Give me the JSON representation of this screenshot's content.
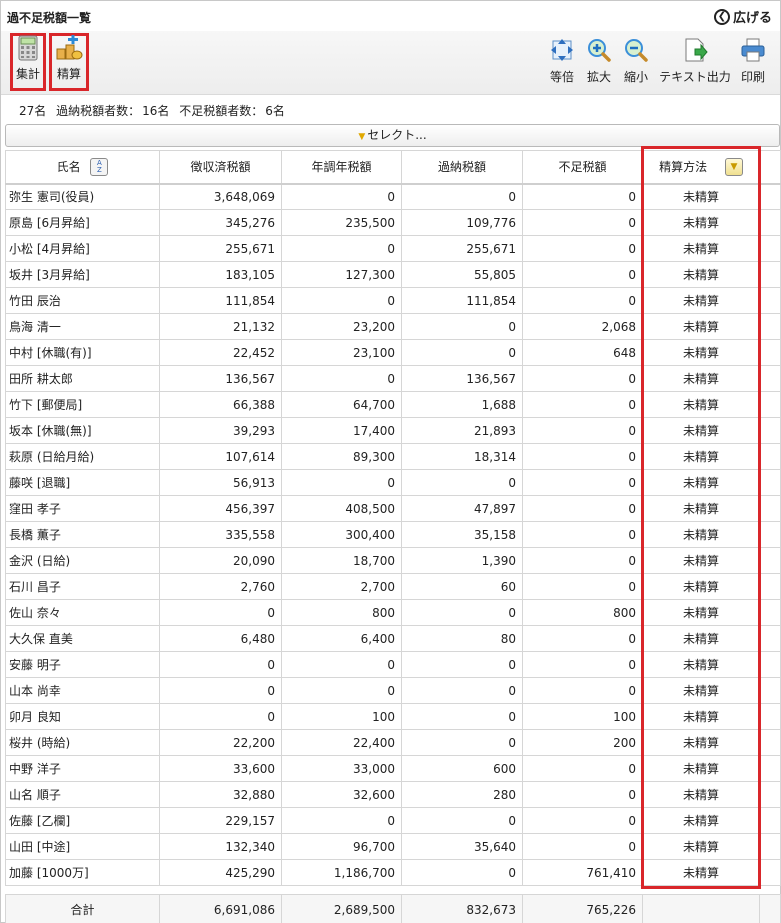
{
  "window": {
    "title": "過不足税額一覧",
    "expand_label": "広げる"
  },
  "toolbar": {
    "left": [
      {
        "label": "集計",
        "icon": "calculator-icon"
      },
      {
        "label": "精算",
        "icon": "settle-icon"
      }
    ],
    "right": [
      {
        "label": "等倍",
        "icon": "actual-size-icon"
      },
      {
        "label": "拡大",
        "icon": "zoom-in-icon"
      },
      {
        "label": "縮小",
        "icon": "zoom-out-icon"
      },
      {
        "label": "テキスト出力",
        "icon": "text-export-icon"
      },
      {
        "label": "印刷",
        "icon": "printer-icon"
      }
    ]
  },
  "summary": {
    "count": "27名",
    "over_label": "過納税額者数：",
    "over_value": "16名",
    "short_label": "不足税額者数：",
    "short_value": "6名"
  },
  "select_bar": {
    "label": "セレクト..."
  },
  "table": {
    "headers": [
      "氏名",
      "徴収済税額",
      "年調年税額",
      "過納税額",
      "不足税額",
      "精算方法"
    ],
    "rows": [
      [
        "弥生 憲司(役員)",
        "3,648,069",
        "0",
        "0",
        "0",
        "未精算"
      ],
      [
        "原島 [6月昇給]",
        "345,276",
        "235,500",
        "109,776",
        "0",
        "未精算"
      ],
      [
        "小松 [4月昇給]",
        "255,671",
        "0",
        "255,671",
        "0",
        "未精算"
      ],
      [
        "坂井 [3月昇給]",
        "183,105",
        "127,300",
        "55,805",
        "0",
        "未精算"
      ],
      [
        "竹田 辰治",
        "111,854",
        "0",
        "111,854",
        "0",
        "未精算"
      ],
      [
        "鳥海 清一",
        "21,132",
        "23,200",
        "0",
        "2,068",
        "未精算"
      ],
      [
        "中村 [休職(有)]",
        "22,452",
        "23,100",
        "0",
        "648",
        "未精算"
      ],
      [
        "田所 耕太郎",
        "136,567",
        "0",
        "136,567",
        "0",
        "未精算"
      ],
      [
        "竹下 [郵便局]",
        "66,388",
        "64,700",
        "1,688",
        "0",
        "未精算"
      ],
      [
        "坂本 [休職(無)]",
        "39,293",
        "17,400",
        "21,893",
        "0",
        "未精算"
      ],
      [
        "萩原 (日給月給)",
        "107,614",
        "89,300",
        "18,314",
        "0",
        "未精算"
      ],
      [
        "藤咲 [退職]",
        "56,913",
        "0",
        "0",
        "0",
        "未精算"
      ],
      [
        "窪田 孝子",
        "456,397",
        "408,500",
        "47,897",
        "0",
        "未精算"
      ],
      [
        "長橋 薫子",
        "335,558",
        "300,400",
        "35,158",
        "0",
        "未精算"
      ],
      [
        "金沢 (日給)",
        "20,090",
        "18,700",
        "1,390",
        "0",
        "未精算"
      ],
      [
        "石川 昌子",
        "2,760",
        "2,700",
        "60",
        "0",
        "未精算"
      ],
      [
        "佐山 奈々",
        "0",
        "800",
        "0",
        "800",
        "未精算"
      ],
      [
        "大久保 直美",
        "6,480",
        "6,400",
        "80",
        "0",
        "未精算"
      ],
      [
        "安藤 明子",
        "0",
        "0",
        "0",
        "0",
        "未精算"
      ],
      [
        "山本 尚幸",
        "0",
        "0",
        "0",
        "0",
        "未精算"
      ],
      [
        "卯月 良知",
        "0",
        "100",
        "0",
        "100",
        "未精算"
      ],
      [
        "桜井 (時給)",
        "22,200",
        "22,400",
        "0",
        "200",
        "未精算"
      ],
      [
        "中野 洋子",
        "33,600",
        "33,000",
        "600",
        "0",
        "未精算"
      ],
      [
        "山名 順子",
        "32,880",
        "32,600",
        "280",
        "0",
        "未精算"
      ],
      [
        "佐藤 [乙欄]",
        "229,157",
        "0",
        "0",
        "0",
        "未精算"
      ],
      [
        "山田 [中途]",
        "132,340",
        "96,700",
        "35,640",
        "0",
        "未精算"
      ],
      [
        "加藤 [1000万]",
        "425,290",
        "1,186,700",
        "0",
        "761,410",
        "未精算"
      ]
    ]
  },
  "totals": {
    "label": "合計",
    "values": [
      "6,691,086",
      "2,689,500",
      "832,673",
      "765,226",
      ""
    ]
  },
  "colors": {
    "highlight": "#d9262a"
  }
}
